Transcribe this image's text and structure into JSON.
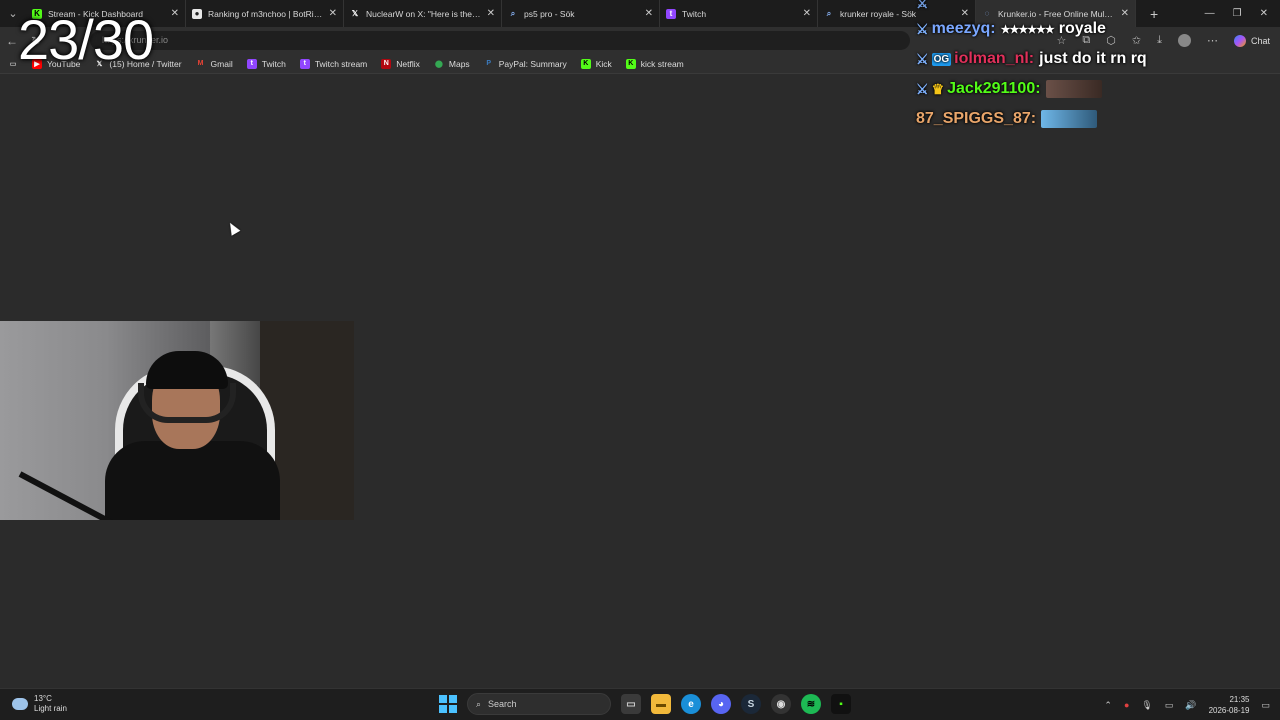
{
  "tabs": [
    {
      "label": "Stream - Kick Dashboard",
      "icon": "kick-icon"
    },
    {
      "label": "Ranking of m3nchoo | BotRix — C",
      "icon": "botrix-icon"
    },
    {
      "label": "NuclearW on X: \"Here is the New",
      "icon": "x-icon"
    },
    {
      "label": "ps5 pro - Sök",
      "icon": "search-icon"
    },
    {
      "label": "Twitch",
      "icon": "twitch-icon"
    },
    {
      "label": "krunker royale - Sök",
      "icon": "search-icon"
    },
    {
      "label": "Krunker.io - Free Online Multiplay",
      "icon": "krunker-icon"
    }
  ],
  "address": {
    "url": "https://krunker.io"
  },
  "toolbar": {
    "chat_label": "Chat"
  },
  "bookmarks": [
    {
      "label": "YouTube"
    },
    {
      "label": "(15) Home / Twitter"
    },
    {
      "label": "Gmail"
    },
    {
      "label": "Twitch"
    },
    {
      "label": "Twitch stream"
    },
    {
      "label": "Netflix"
    },
    {
      "label": "Maps"
    },
    {
      "label": "PayPal: Summary"
    },
    {
      "label": "Kick"
    },
    {
      "label": "kick stream"
    }
  ],
  "counter": {
    "text": "23/30"
  },
  "chat": [
    {
      "user": "meezyq:",
      "text": "royale",
      "color": "#7aa7ff",
      "badge": "sword"
    },
    {
      "user": "iolman_nl:",
      "text": "just do it rn rq",
      "color": "#e0305a",
      "badge": "sword-og"
    },
    {
      "user": "Jack291100:",
      "text": "",
      "color": "#53fc18",
      "badge": "sword-crown"
    },
    {
      "user": "87_SPIGGS_87:",
      "text": "",
      "color": "#e8a56a",
      "badge": ""
    }
  ],
  "taskbar": {
    "weather_temp": "13°C",
    "weather_desc": "Light rain",
    "search_label": "Search",
    "time": "21:35",
    "date": "2026-08-19"
  }
}
